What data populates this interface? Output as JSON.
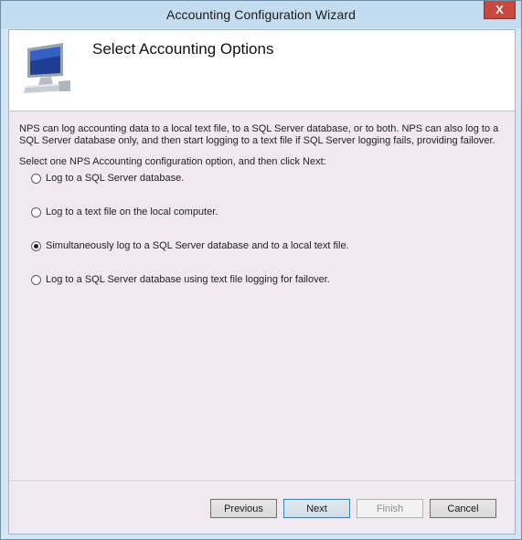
{
  "window": {
    "title": "Accounting Configuration Wizard",
    "close_glyph": "X"
  },
  "header": {
    "title": "Select Accounting Options",
    "icon": "computer-monitor-icon"
  },
  "body": {
    "description": "NPS can log accounting data to a local text file, to a SQL Server database, or to both. NPS can also log to a SQL Server database only, and then start logging to a text file if SQL Server logging fails, providing failover.",
    "select_label": "Select one NPS Accounting configuration option, and then click Next:",
    "options": [
      {
        "label": "Log to a SQL Server database.",
        "checked": false
      },
      {
        "label": "Log to a text file on the local computer.",
        "checked": false
      },
      {
        "label": "Simultaneously log to a SQL Server database and to a local text file.",
        "checked": true
      },
      {
        "label": "Log to a SQL Server database using text file logging for failover.",
        "checked": false
      }
    ]
  },
  "buttons": {
    "previous": "Previous",
    "next": "Next",
    "finish": "Finish",
    "cancel": "Cancel"
  },
  "colors": {
    "title_bar": "#c4dcef",
    "close_button": "#c7483f",
    "content_background": "#f1e9f0",
    "header_background": "#ffffff"
  }
}
